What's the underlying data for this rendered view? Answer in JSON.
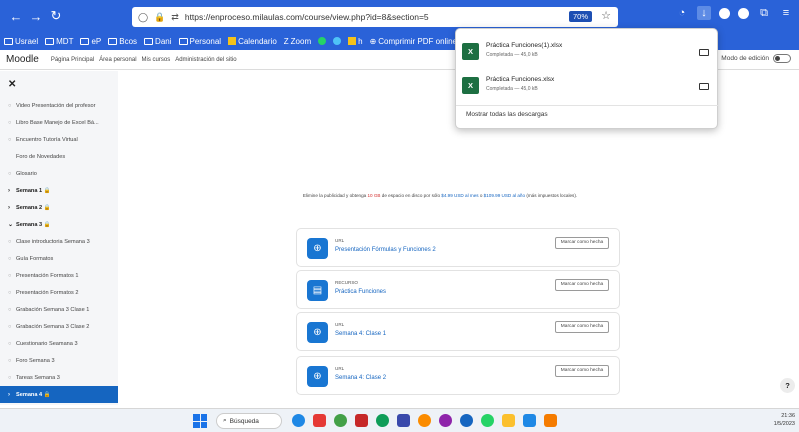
{
  "browser": {
    "url": "https://enproceso.milaulas.com/course/view.php?id=8&section=5",
    "zoom": "70%",
    "bookmarks": [
      "Usrael",
      "MDT",
      "eP",
      "Bcos",
      "Dani",
      "Personal",
      "Calendario",
      "Zoom",
      "h",
      "Comprimir PDF online..."
    ]
  },
  "moodle": {
    "brand": "Moodle",
    "nav": [
      "Página Principal",
      "Área personal",
      "Mis cursos",
      "Administración del sitio"
    ],
    "edit_mode": "Modo de edición"
  },
  "sidebar": {
    "items": [
      {
        "label": "Video Presentación del profesor",
        "kind": "activity"
      },
      {
        "label": "Libro Base Manejo de Excel Bá...",
        "kind": "activity"
      },
      {
        "label": "Encuentro Tutoría Virtual",
        "kind": "activity"
      },
      {
        "label": "Foro de Novedades",
        "kind": "plain"
      },
      {
        "label": "Glosario",
        "kind": "activity"
      },
      {
        "label": "Semana 1 🔒",
        "kind": "section",
        "marker": "›"
      },
      {
        "label": "Semana 2 🔒",
        "kind": "section",
        "marker": "›"
      },
      {
        "label": "Semana 3 🔒",
        "kind": "section",
        "marker": "⌄"
      },
      {
        "label": "Clase introductoria Semana 3",
        "kind": "activity"
      },
      {
        "label": "Guía Formatos",
        "kind": "activity"
      },
      {
        "label": "Presentación Formatos 1",
        "kind": "activity"
      },
      {
        "label": "Presentación Formatos 2",
        "kind": "activity"
      },
      {
        "label": "Grabación Semana 3 Clase 1",
        "kind": "activity"
      },
      {
        "label": "Grabación Semana 3 Clase 2",
        "kind": "activity"
      },
      {
        "label": "Cuestionario Seamana 3",
        "kind": "activity"
      },
      {
        "label": "Foro Semana 3",
        "kind": "activity"
      },
      {
        "label": "Tareas Semana 3",
        "kind": "activity"
      },
      {
        "label": "Semana 4 🔒",
        "kind": "active",
        "marker": "›"
      }
    ]
  },
  "ad": {
    "before": "Elimine la publicidad y obtenga ",
    "highlight": "10 GB",
    "middle": " de espacio en disco por sólo ",
    "link1": "$4.99 USD al mes",
    "or": " o ",
    "link2": "$109.99 USD al año",
    "after": " (más impuestos locales)."
  },
  "activities": [
    {
      "type": "URL",
      "name": "Presentación Fórmulas y Funciones 2",
      "icon": "globe-icon",
      "button": "Marcar como hecha"
    },
    {
      "type": "RECURSO",
      "name": "Práctica Funciones",
      "icon": "file-icon",
      "button": "Marcar como hecha"
    },
    {
      "type": "URL",
      "name": "Semana 4: Clase 1",
      "icon": "globe-icon",
      "button": "Marcar como hecha"
    },
    {
      "type": "URL",
      "name": "Semana 4: Clase 2",
      "icon": "globe-icon",
      "button": "Marcar como hecha"
    }
  ],
  "downloads": {
    "items": [
      {
        "name": "Práctica Funciones(1).xlsx",
        "status": "Completada — 45,0 kB"
      },
      {
        "name": "Práctica Funciones.xlsx",
        "status": "Completada — 45,0 kB"
      }
    ],
    "show_all": "Mostrar todas las descargas"
  },
  "help": "?",
  "taskbar": {
    "search": "Búsqueda",
    "time": "21:36",
    "date": "1/5/2023"
  },
  "colors": {
    "chrome": "#2a62d8",
    "link": "#1565c0",
    "active": "#1565c0",
    "excel": "#1d6f42"
  }
}
